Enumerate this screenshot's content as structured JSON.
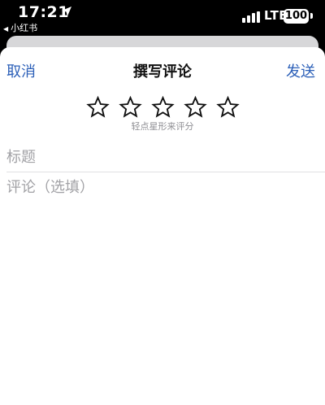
{
  "status_bar": {
    "time": "17:21",
    "back_app": "小红书",
    "network": "LTE",
    "battery": "100"
  },
  "nav": {
    "cancel_label": "取消",
    "title": "撰写评论",
    "send_label": "发送"
  },
  "rating": {
    "star_glyph": "☆",
    "max_stars": 5,
    "hint": "轻点星形来评分"
  },
  "form": {
    "title_placeholder": "标题",
    "comment_placeholder": "评论（选填）"
  },
  "colors": {
    "accent": "#2b5fb8",
    "placeholder": "#a2a2a6"
  }
}
